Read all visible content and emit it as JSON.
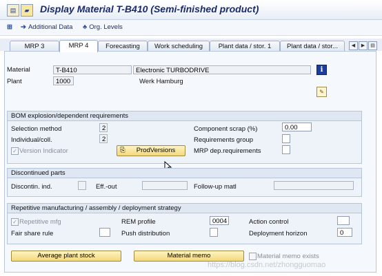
{
  "window": {
    "title": "Display Material T-B410 (Semi-finished product)"
  },
  "toolbar": {
    "additional_data": "Additional Data",
    "org_levels": "Org. Levels"
  },
  "tabs": [
    {
      "label": "MRP 3",
      "active": false
    },
    {
      "label": "MRP 4",
      "active": true
    },
    {
      "label": "Forecasting",
      "active": false
    },
    {
      "label": "Work scheduling",
      "active": false
    },
    {
      "label": "Plant data / stor. 1",
      "active": false
    },
    {
      "label": "Plant data / stor...",
      "active": false
    }
  ],
  "header": {
    "material_label": "Material",
    "material_value": "T-B410",
    "material_desc": "Electronic TURBODRIVE",
    "plant_label": "Plant",
    "plant_value": "1000",
    "plant_desc": "Werk Hamburg"
  },
  "bom": {
    "title": "BOM explosion/dependent requirements",
    "selection_method_label": "Selection method",
    "selection_method_value": "2",
    "individual_coll_label": "Individual/coll.",
    "individual_coll_value": "2",
    "version_indicator_label": "Version Indicator",
    "version_indicator_checked": true,
    "prodversions_button": "ProdVersions",
    "component_scrap_label": "Component scrap (%)",
    "component_scrap_value": "0.00",
    "requirements_group_label": "Requirements group",
    "mrp_dep_req_label": "MRP dep.requirements"
  },
  "discontinued": {
    "title": "Discontinued parts",
    "discontin_ind_label": "Discontin. ind.",
    "eff_out_label": "Eff.-out",
    "followup_label": "Follow-up matl"
  },
  "repetitive": {
    "title": "Repetitive manufacturing / assembly / deployment strategy",
    "repetitive_mfg_label": "Repetitive mfg",
    "repetitive_mfg_checked": true,
    "rem_profile_label": "REM profile",
    "rem_profile_value": "0004",
    "action_control_label": "Action control",
    "fair_share_label": "Fair share rule",
    "push_distribution_label": "Push distribution",
    "deployment_horizon_label": "Deployment horizon",
    "deployment_horizon_value": "0"
  },
  "footer": {
    "average_plant_stock": "Average plant stock",
    "material_memo": "Material memo",
    "material_memo_exists": "Material memo exists"
  },
  "watermark": "https://blog.csdn.net/zhongguomao"
}
